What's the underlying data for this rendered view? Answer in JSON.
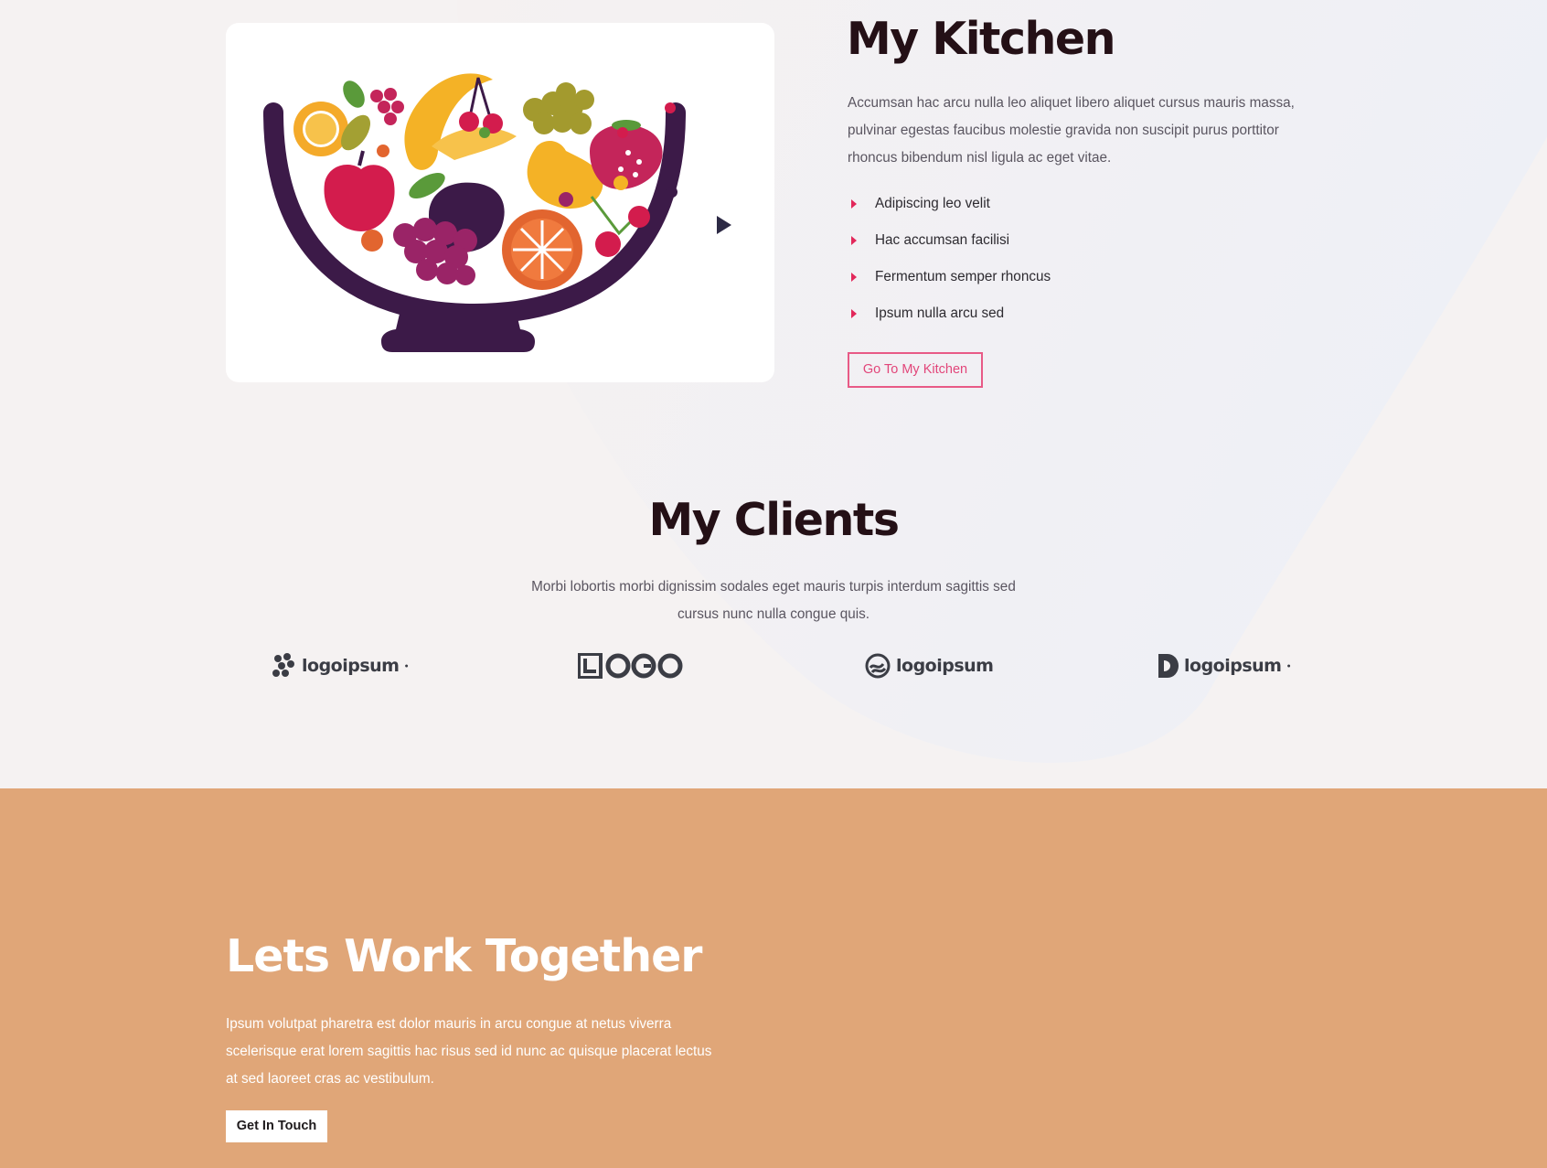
{
  "colors": {
    "accent": "#e2285a",
    "heading": "#241016",
    "cta_section_bg": "#e0a678"
  },
  "kitchen": {
    "title": "My Kitchen",
    "description": "Accumsan hac arcu nulla leo aliquet libero aliquet cursus mauris massa, pulvinar egestas faucibus molestie gravida non suscipit purus porttitor rhoncus bibendum nisl ligula ac eget vitae.",
    "features": [
      "Adipiscing leo velit",
      "Hac accumsan facilisi",
      "Fermentum semper rhoncus",
      "Ipsum nulla arcu sed"
    ],
    "button_label": "Go To My Kitchen",
    "media_icon": "play-icon"
  },
  "clients": {
    "title": "My Clients",
    "description": "Morbi lobortis morbi dignissim sodales eget mauris turpis interdum sagittis sed cursus nunc nulla congue quis.",
    "logos": [
      {
        "text": "logoipsum",
        "icon": "chain-dots-icon"
      },
      {
        "text": "LOGO",
        "icon": "logo-wordmark"
      },
      {
        "text": "logoipsum",
        "icon": "wave-circle-icon"
      },
      {
        "text": "logoipsum",
        "icon": "half-circle-icon"
      }
    ]
  },
  "cta": {
    "title": "Lets Work Together",
    "description": "Ipsum volutpat pharetra est dolor mauris in arcu congue at netus viverra scelerisque erat lorem sagittis hac risus sed id nunc ac quisque placerat lectus at sed laoreet cras ac vestibulum.",
    "button_label": "Get In Touch"
  }
}
